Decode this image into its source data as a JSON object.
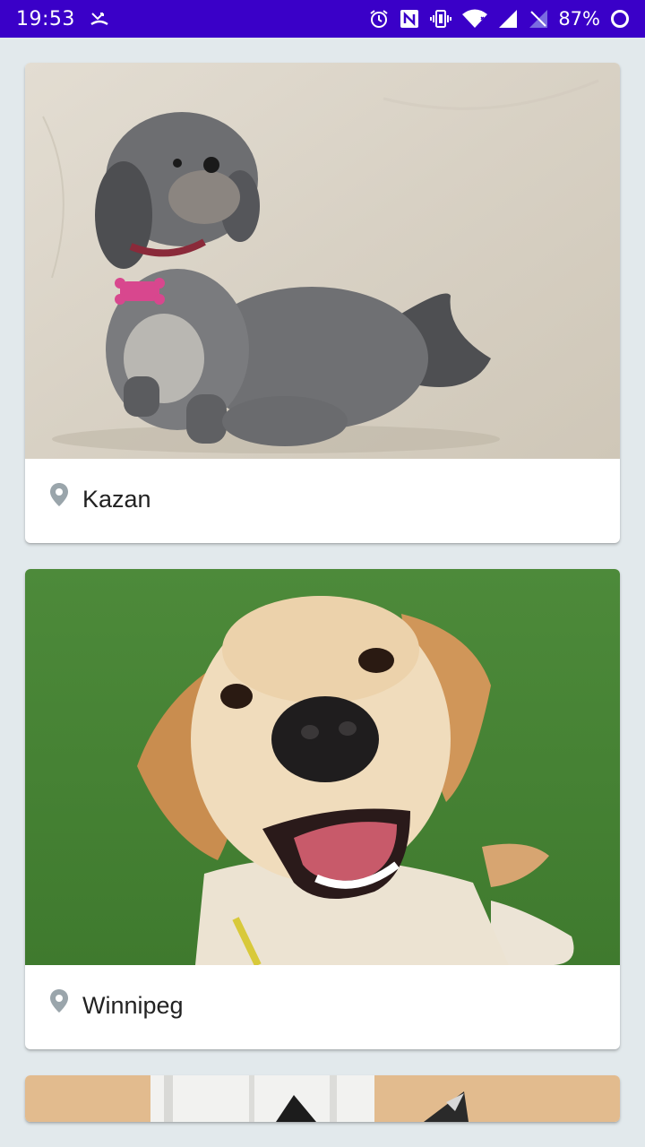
{
  "status_bar": {
    "time": "19:53",
    "battery_percent": "87%",
    "icons": [
      "missed-call-icon",
      "alarm-icon",
      "nfc-icon",
      "vibrate-icon",
      "wifi-icon",
      "signal-icon",
      "no-sim-signal-icon",
      "battery-ring-icon"
    ]
  },
  "feed": {
    "cards": [
      {
        "photo": "gray shih tzu dog sitting on concrete",
        "location_icon": "location-pin-icon",
        "city": "Kazan"
      },
      {
        "photo": "smiling yellow labrador puppy on grass",
        "location_icon": "location-pin-icon",
        "city": "Winnipeg"
      },
      {
        "photo": "dog with pointed ears in room",
        "location_icon": "location-pin-icon",
        "city": ""
      }
    ]
  },
  "colors": {
    "status_bar": "#3a00c8",
    "background": "#e2e9ec",
    "card": "#ffffff",
    "pin": "#9aa5ab",
    "city_text": "#222222"
  }
}
